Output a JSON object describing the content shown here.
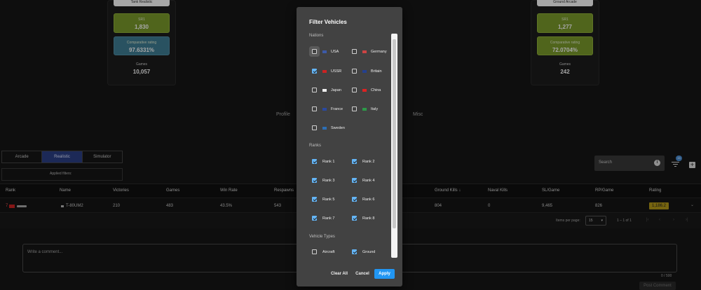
{
  "cards": [
    {
      "mode": "Tank Realistic",
      "sr_label": "SR1",
      "sr_value": "1,830",
      "cmp_label": "Comparative rating",
      "cmp_value": "97.6331%",
      "cmp_color": "#3f7f96",
      "games_label": "Games",
      "games_value": "10,057"
    },
    {
      "mode": "Ground Arcade",
      "sr_label": "SR1",
      "sr_value": "1,277",
      "cmp_label": "Comparative rating",
      "cmp_value": "72.0704%",
      "cmp_color": "#7b9c2c",
      "games_label": "Games",
      "games_value": "242"
    }
  ],
  "section_labels": {
    "profile": "Profile",
    "misc": "Misc"
  },
  "tabs": [
    "Arcade",
    "Realistic",
    "Simulator"
  ],
  "applied_filters": "Applied filters:",
  "search": {
    "placeholder": "Search",
    "badge": "15"
  },
  "table": {
    "headers": [
      "Rank",
      "Name",
      "Victories",
      "Games",
      "Win Rate",
      "Respawns",
      "Ground Kills ↓",
      "Naval Kills",
      "SL/Game",
      "RP/Game",
      "Rating"
    ],
    "row": {
      "rank": "7",
      "name": "T-80UM2",
      "victories": "210",
      "games": "483",
      "win_rate": "43.5%",
      "respawns": "543",
      "ground_kills": "804",
      "naval_kills": "0",
      "sl_game": "9,465",
      "rp_game": "826",
      "rating": "1,186.2"
    }
  },
  "pagination": {
    "label": "Items per page:",
    "per_page": "15",
    "range": "1 – 1 of 1"
  },
  "comment": {
    "placeholder": "Write a comment...",
    "counter": "0 / 500",
    "post": "Post Comment"
  },
  "dialog": {
    "title": "Filter Vehicles",
    "nations_title": "Nations",
    "nations": [
      {
        "name": "USA",
        "checked": false,
        "flag": "#3c5aa8"
      },
      {
        "name": "Germany",
        "checked": false,
        "flag": "#c44"
      },
      {
        "name": "USSR",
        "checked": true,
        "flag": "#c22"
      },
      {
        "name": "Britain",
        "checked": false,
        "flag": "#24408e"
      },
      {
        "name": "Japan",
        "checked": false,
        "flag": "#eee"
      },
      {
        "name": "China",
        "checked": false,
        "flag": "#d22"
      },
      {
        "name": "France",
        "checked": false,
        "flag": "#2a49a0"
      },
      {
        "name": "Italy",
        "checked": false,
        "flag": "#2c9a48"
      },
      {
        "name": "Sweden",
        "checked": false,
        "flag": "#2d6fb5"
      }
    ],
    "ranks_title": "Ranks",
    "ranks": [
      "Rank 1",
      "Rank 2",
      "Rank 3",
      "Rank 4",
      "Rank 5",
      "Rank 6",
      "Rank 7",
      "Rank 8"
    ],
    "types_title": "Vehicle Types",
    "types": [
      {
        "name": "Aircraft",
        "checked": false
      },
      {
        "name": "Ground",
        "checked": true
      }
    ],
    "clear_all": "Clear All",
    "cancel": "Cancel",
    "apply": "Apply"
  }
}
